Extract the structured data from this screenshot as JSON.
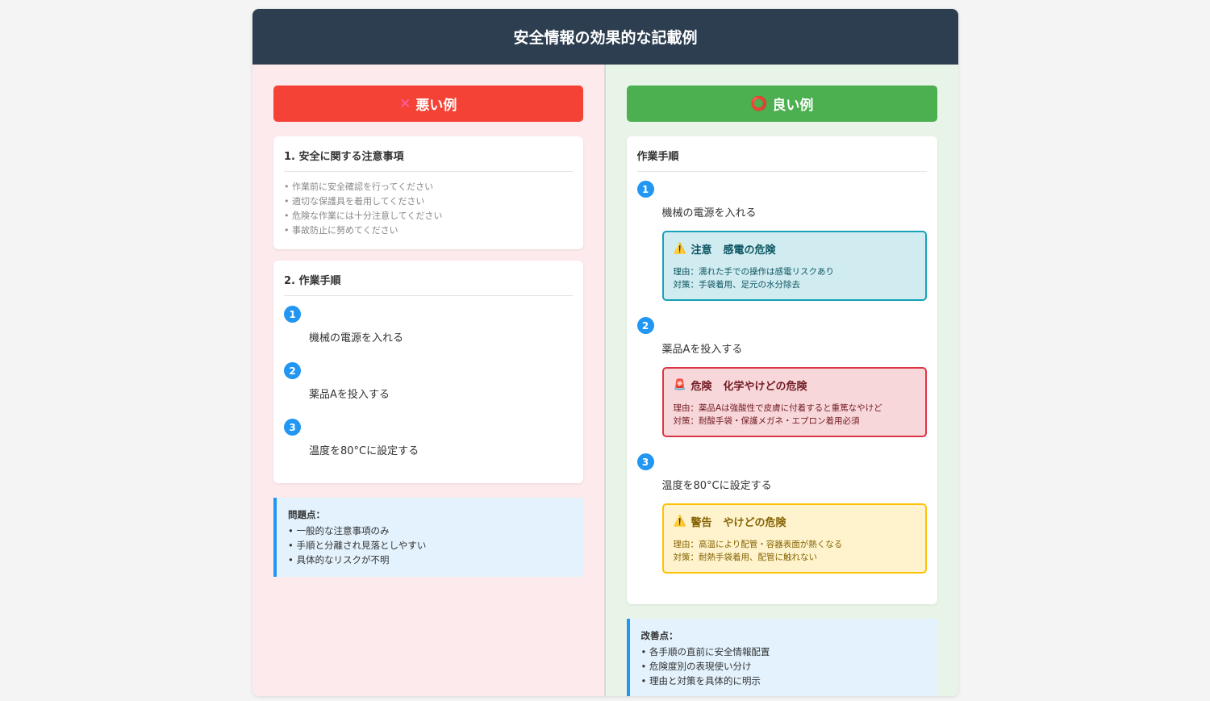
{
  "title": "安全情報の効果的な記載例",
  "bad": {
    "banner_mark": "✕",
    "banner_label": "悪い例",
    "safety_card": {
      "title": "1. 安全に関する注意事項",
      "items": [
        "• 作業前に安全確認を行ってください",
        "• 適切な保護具を着用してください",
        "• 危険な作業には十分注意してください",
        "• 事故防止に努めてください"
      ]
    },
    "procedure_card": {
      "title": "2. 作業手順",
      "steps": [
        {
          "num": "1",
          "text": "機械の電源を入れる"
        },
        {
          "num": "2",
          "text": "薬品Aを投入する"
        },
        {
          "num": "3",
          "text": "温度を80°Cに設定する"
        }
      ]
    },
    "note": {
      "title": "問題点：",
      "items": [
        "• 一般的な注意事項のみ",
        "• 手順と分離され見落としやすい",
        "• 具体的なリスクが不明"
      ]
    }
  },
  "good": {
    "banner_mark": "⭕",
    "banner_label": "良い例",
    "procedure_card": {
      "title": "作業手順",
      "steps": [
        {
          "num": "1",
          "text": "機械の電源を入れる",
          "alert": {
            "icon": "⚠️",
            "level": "注意",
            "hazard": "感電の危険",
            "reason": "理由：濡れた手での操作は感電リスクあり",
            "measure": "対策：手袋着用、足元の水分除去"
          }
        },
        {
          "num": "2",
          "text": "薬品Aを投入する",
          "alert": {
            "icon": "🚨",
            "level": "危険",
            "hazard": "化学やけどの危険",
            "reason": "理由：薬品Aは強酸性で皮膚に付着すると重篤なやけど",
            "measure": "対策：耐酸手袋・保護メガネ・エプロン着用必須"
          }
        },
        {
          "num": "3",
          "text": "温度を80°Cに設定する",
          "alert": {
            "icon": "⚠️",
            "level": "警告",
            "hazard": "やけどの危険",
            "reason": "理由：高温により配管・容器表面が熱くなる",
            "measure": "対策：耐熱手袋着用、配管に触れない"
          }
        }
      ]
    },
    "note": {
      "title": "改善点：",
      "items": [
        "• 各手順の直前に安全情報配置",
        "• 危険度別の表現使い分け",
        "• 理由と対策を具体的に明示"
      ]
    }
  },
  "colors": {
    "header": "#2c3e50",
    "bad_banner": "#f44336",
    "good_banner": "#4caf50",
    "step_number": "#2196f3",
    "caution": "#17a2b8",
    "danger": "#dc3545",
    "warning": "#ffc107"
  }
}
